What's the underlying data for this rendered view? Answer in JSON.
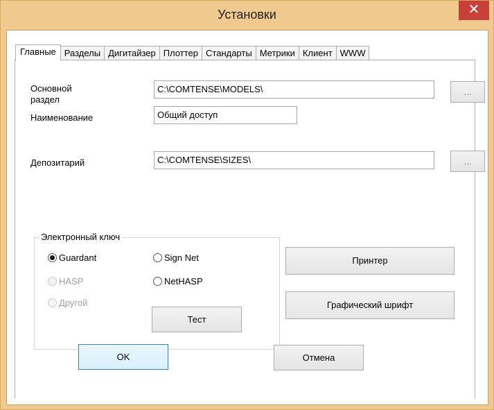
{
  "window": {
    "title": "Установки",
    "close_glyph": "✕"
  },
  "tabs": [
    {
      "label": "Главные",
      "active": true
    },
    {
      "label": "Разделы"
    },
    {
      "label": "Дигитайзер"
    },
    {
      "label": "Плоттер"
    },
    {
      "label": "Стандарты"
    },
    {
      "label": "Метрики"
    },
    {
      "label": "Клиент"
    },
    {
      "label": "WWW"
    }
  ],
  "main": {
    "base_section_label_line1": "Основной",
    "base_section_label_line2": "раздел",
    "base_section_value": "C:\\COMTENSE\\MODELS\\",
    "name_label": "Наименование",
    "name_value": "Общий доступ",
    "depository_label": "Депозитарий",
    "depository_value": "C:\\COMTENSE\\SIZES\\",
    "browse_label": "..."
  },
  "key_group": {
    "title": "Электронный ключ",
    "options": [
      {
        "label": "Guardant",
        "checked": true,
        "enabled": true
      },
      {
        "label": "Sign Net",
        "checked": false,
        "enabled": true
      },
      {
        "label": "HASP",
        "checked": false,
        "enabled": false
      },
      {
        "label": "NetHASP",
        "checked": false,
        "enabled": true
      },
      {
        "label": "Другой",
        "checked": false,
        "enabled": false
      }
    ],
    "test_label": "Тест"
  },
  "buttons": {
    "printer_label": "Принтер",
    "graphic_font_label": "Графический шрифт",
    "ok_label": "OK",
    "cancel_label": "Отмена"
  }
}
